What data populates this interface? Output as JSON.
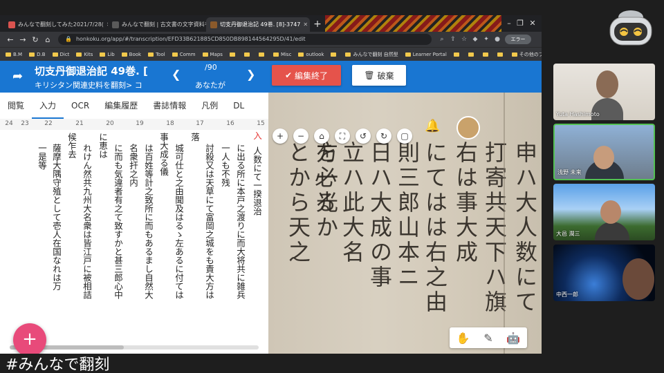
{
  "browser": {
    "tabs": [
      {
        "label": "みんなで翻刻してみた2021/7/28(",
        "active": false
      },
      {
        "label": "みんなで翻刻 | 古文書の文字資料を",
        "active": false
      },
      {
        "label": "切支丹御退治記 49巻. [8]-3747",
        "active": true
      }
    ],
    "url": "honkoku.org/app/#/transcription/EFD33B621885CD850DB898144564295D/41/edit",
    "profile_label": "エラー",
    "bookmarks": [
      "B.M",
      "D.B",
      "Dict",
      "Kits",
      "Lib",
      "Book",
      "Tool",
      "Comm",
      "Maps",
      "",
      "",
      "",
      "Misc",
      "outlook",
      "",
      "みんなで翻刻 自然型",
      "Learner Portal",
      "",
      "",
      "",
      "",
      "その他のブックマーク"
    ]
  },
  "app": {
    "title": "切支丹御退治記 49巻. [",
    "breadcrumb": "キリシタン関連史料を翻刻> コ",
    "page_count": "/90",
    "page_author": "あなたが",
    "finish_label": "編集終了",
    "discard_label": "破棄",
    "tabs": [
      "閲覧",
      "入力",
      "OCR",
      "編集履歴",
      "書誌情報",
      "凡例",
      "DL"
    ],
    "active_tab": "入力",
    "column_numbers": [
      "24",
      "23",
      "22",
      "21",
      "20",
      "19",
      "18",
      "17",
      "16",
      "15"
    ],
    "columns": [
      {
        "text": "人数にて一揆退治",
        "red": false
      },
      {
        "text": "入",
        "red": true
      },
      {
        "text": "に出る所に本戸之渡りに而大将共に雑兵",
        "red": false
      },
      {
        "text": "一人も不残",
        "red": false
      },
      {
        "text": "討殺又は天草にて富岡之城をも責大方は",
        "red": false
      },
      {
        "text": "落",
        "red": false
      },
      {
        "text": "城可仕と之由聞及はるゝ左あるに付ては",
        "red": false
      },
      {
        "text": "事大成る儀",
        "red": false
      },
      {
        "text": "は百姓等計之致所に而もあるまし自然大",
        "red": false
      },
      {
        "text": "名衆扞之内",
        "red": false
      },
      {
        "text": "に而も気違者有之て致すかと甚三郎心中",
        "red": false
      },
      {
        "text": "に恵は",
        "red": false
      },
      {
        "text": "れけん然共九州大名衆は皆江戸に被相詰",
        "red": false
      },
      {
        "text": "候乍去",
        "red": false
      },
      {
        "text": "薩摩大隅守殖として壱人在国なれは万",
        "red": false
      },
      {
        "text": "一是等",
        "red": false
      }
    ],
    "manuscript_columns": [
      "申ハ大人数にて",
      "打寄共天下ハ旗",
      "右は事大成",
      "にてはは右之由",
      "則三郎山本ニ",
      "日ハ大成の事",
      "立ハ此大名",
      "を必る",
      "とから天之",
      "方一光か"
    ]
  },
  "participants": [
    {
      "name": "Yuta Hashimoto",
      "active": false
    },
    {
      "name": "浅野 未来",
      "active": true
    },
    {
      "name": "大邑 潤三",
      "active": false
    },
    {
      "name": "中西一郎",
      "active": false
    }
  ],
  "caption": "#みんなで翻刻"
}
